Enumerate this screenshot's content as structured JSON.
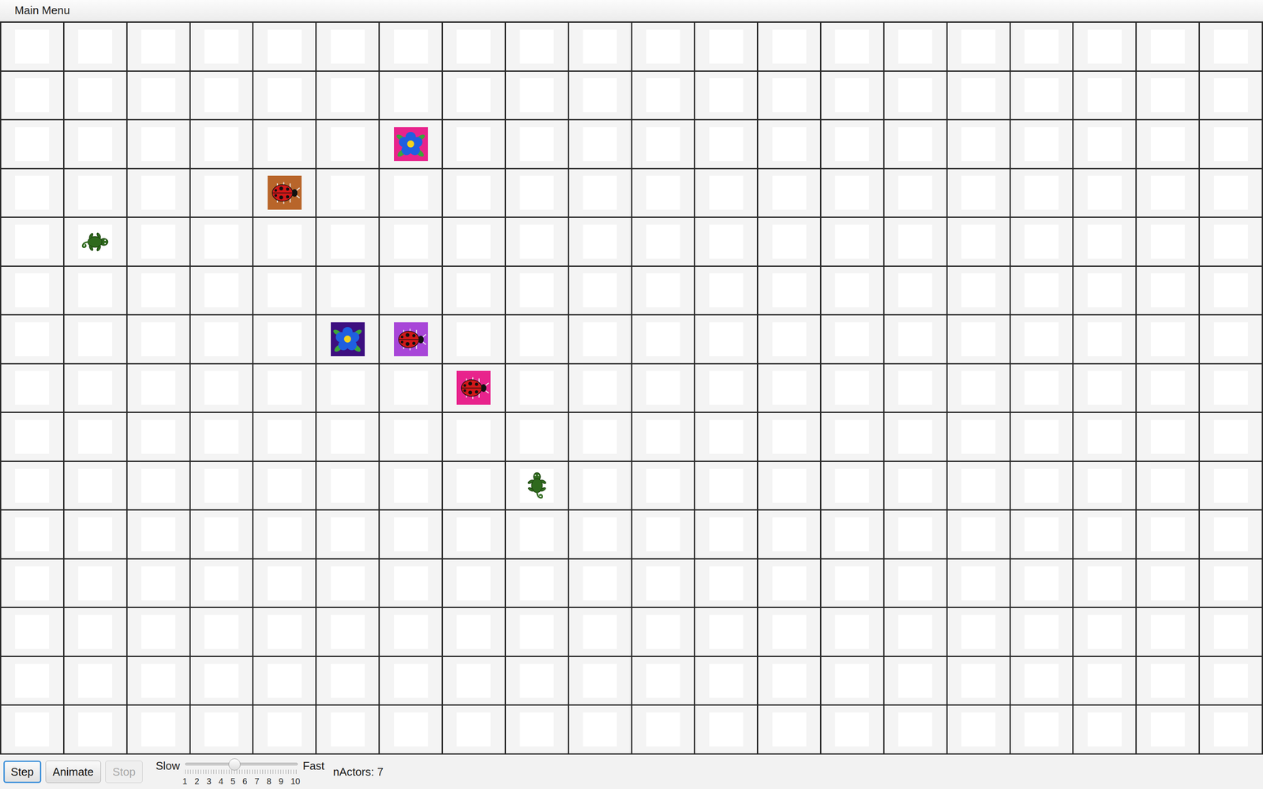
{
  "menu": [
    {
      "label": "Main Menu"
    }
  ],
  "grid": {
    "rows": 15,
    "cols": 20
  },
  "actors": [
    {
      "kind": "flower",
      "row": 2,
      "col": 6,
      "direction": 0,
      "color": "#e8238c"
    },
    {
      "kind": "bug",
      "row": 3,
      "col": 4,
      "direction": 90,
      "color": "#b8652a"
    },
    {
      "kind": "critter",
      "row": 4,
      "col": 1,
      "direction": 90,
      "color": "#ffffff"
    },
    {
      "kind": "flower",
      "row": 6,
      "col": 5,
      "direction": 0,
      "color": "#3d0f80"
    },
    {
      "kind": "bug",
      "row": 6,
      "col": 6,
      "direction": 90,
      "color": "#a846d8"
    },
    {
      "kind": "bug",
      "row": 7,
      "col": 7,
      "direction": 90,
      "color": "#e8238c"
    },
    {
      "kind": "critter",
      "row": 9,
      "col": 8,
      "direction": 0,
      "color": "#ffffff"
    }
  ],
  "controls": {
    "buttons": [
      {
        "label": "Step",
        "selected": true,
        "disabled": false
      },
      {
        "label": "Animate",
        "selected": false,
        "disabled": false
      },
      {
        "label": "Stop",
        "selected": false,
        "disabled": true
      }
    ],
    "speed": {
      "min_label": "Slow",
      "max_label": "Fast",
      "level": 0.44,
      "ticks": [
        "1",
        "2",
        "3",
        "4",
        "5",
        "6",
        "7",
        "8",
        "9",
        "10"
      ]
    }
  },
  "status": "nActors: 7"
}
